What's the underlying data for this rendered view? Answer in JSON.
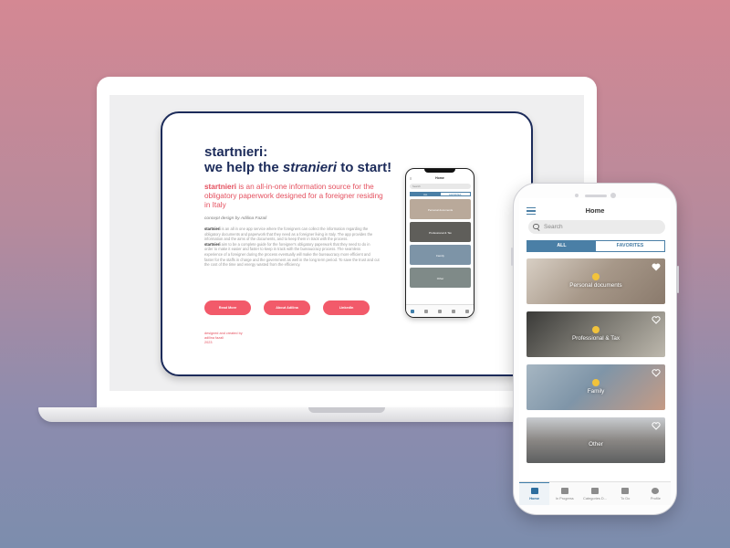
{
  "web": {
    "title_line1": "startnieri:",
    "title_line2_pre": "we help the ",
    "title_line2_em": "stranieri",
    "title_line2_post": " to start!",
    "subtitle_bold": "startnieri",
    "subtitle_rest": " is an all-in-one information source for the obligatory paperwork designed for a foreigner residing in Italy",
    "concept": "concept design by Adilina Fazali",
    "body_p1_bold": "startnieri",
    "body_p1": " is an all in one app service where the foreigners can collect the information regarding the obligatory documents and paperwork that they need as a foreigner living in Italy. The app provides the information and the aims of the documents, and to keep them in track with the process.",
    "body_p2_bold": "startnieri",
    "body_p2": " aim to be a complete guide for the foreigner's obligatory paperwork that they need to do in order to make it easier and faster to keep in track with the bureaucracy process. The seamless experience of a foreigner during the process eventually will make the bureaucracy more efficient and faster for the staffs in charge and the government as well in the long term period. To save the trust and cut the cost of the time and energy wasted from the efficiency.",
    "buttons": [
      "Read More",
      "About Adilina",
      "LinkedIn"
    ],
    "credit": "designed and created by\nadilina fazali\n2023"
  },
  "app": {
    "title": "Home",
    "search_placeholder": "Search",
    "tabs": [
      "ALL",
      "FAVORITES"
    ],
    "cards": [
      {
        "label": "Personal documents",
        "color": "#b9a99a"
      },
      {
        "label": "Professional & Tax",
        "color": "#6b6a66"
      },
      {
        "label": "Family",
        "color": "#7d94a7"
      },
      {
        "label": "Other",
        "color": "#8d8e8d"
      }
    ],
    "nav": [
      "Home",
      "In Progress",
      "Categories D...",
      "To Do",
      "Profile"
    ],
    "accent": "#4a7fa6"
  }
}
